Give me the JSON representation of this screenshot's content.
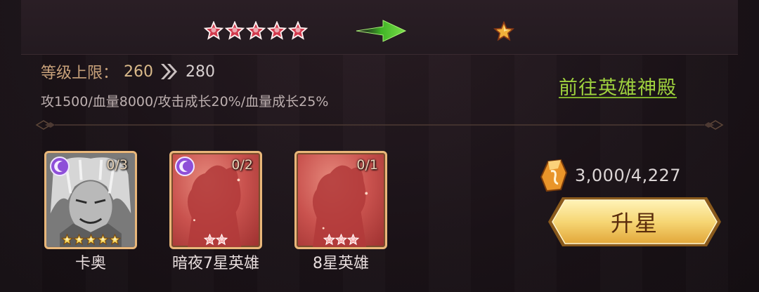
{
  "star_upgrade": {
    "current_stars": 5,
    "next_stars": 1,
    "current_star_color": "#d23a4d",
    "next_star_color": "#e7a12e"
  },
  "level": {
    "label": "等级上限：",
    "from": "260",
    "to": "280"
  },
  "stats_text": "攻1500/血量8000/攻击成长20%/血量成长25%",
  "goto_link": "前往英雄神殿",
  "materials": [
    {
      "name": "卡奥",
      "count": "0/3",
      "stars": 5,
      "type": "hero"
    },
    {
      "name": "暗夜7星英雄",
      "count": "0/2",
      "stars": 2,
      "type": "silhouette"
    },
    {
      "name": "8星英雄",
      "count": "0/1",
      "stars": 3,
      "type": "silhouette"
    }
  ],
  "cost": {
    "text": "3,000/4,227",
    "icon": "rune-stone-icon"
  },
  "upgrade_button": "升星",
  "colors": {
    "link": "#9fd23e",
    "button_gold": "#f6d674",
    "card_border": "#e9b77a",
    "card_red": "#c9524e"
  }
}
